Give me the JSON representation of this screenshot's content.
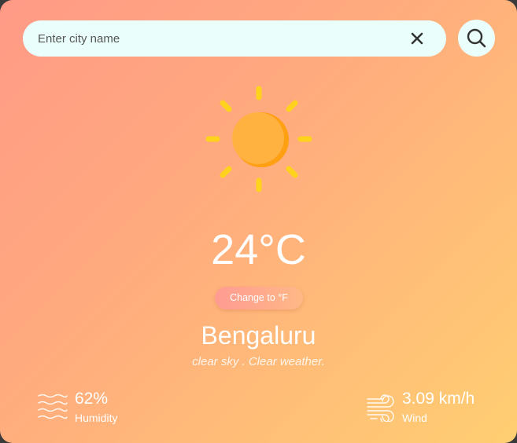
{
  "search": {
    "placeholder": "Enter city name",
    "value": ""
  },
  "icons": {
    "clear": "close-icon",
    "search": "search-icon",
    "weather": "sun-icon",
    "humidity": "waves-icon",
    "wind": "wind-icon"
  },
  "weather": {
    "temperature": "24°C",
    "unit_toggle_label": "Change to °F",
    "city": "Bengaluru",
    "description": "clear sky . Clear weather."
  },
  "stats": {
    "humidity": {
      "value": "62%",
      "label": "Humidity"
    },
    "wind": {
      "value": "3.09 km/h",
      "label": "Wind"
    }
  },
  "colors": {
    "gradient_start": "#ff9a86",
    "gradient_end": "#ffce72",
    "search_bg": "#eafffb",
    "sun_body": "#ffb23f",
    "sun_rays": "#ffd21e"
  }
}
